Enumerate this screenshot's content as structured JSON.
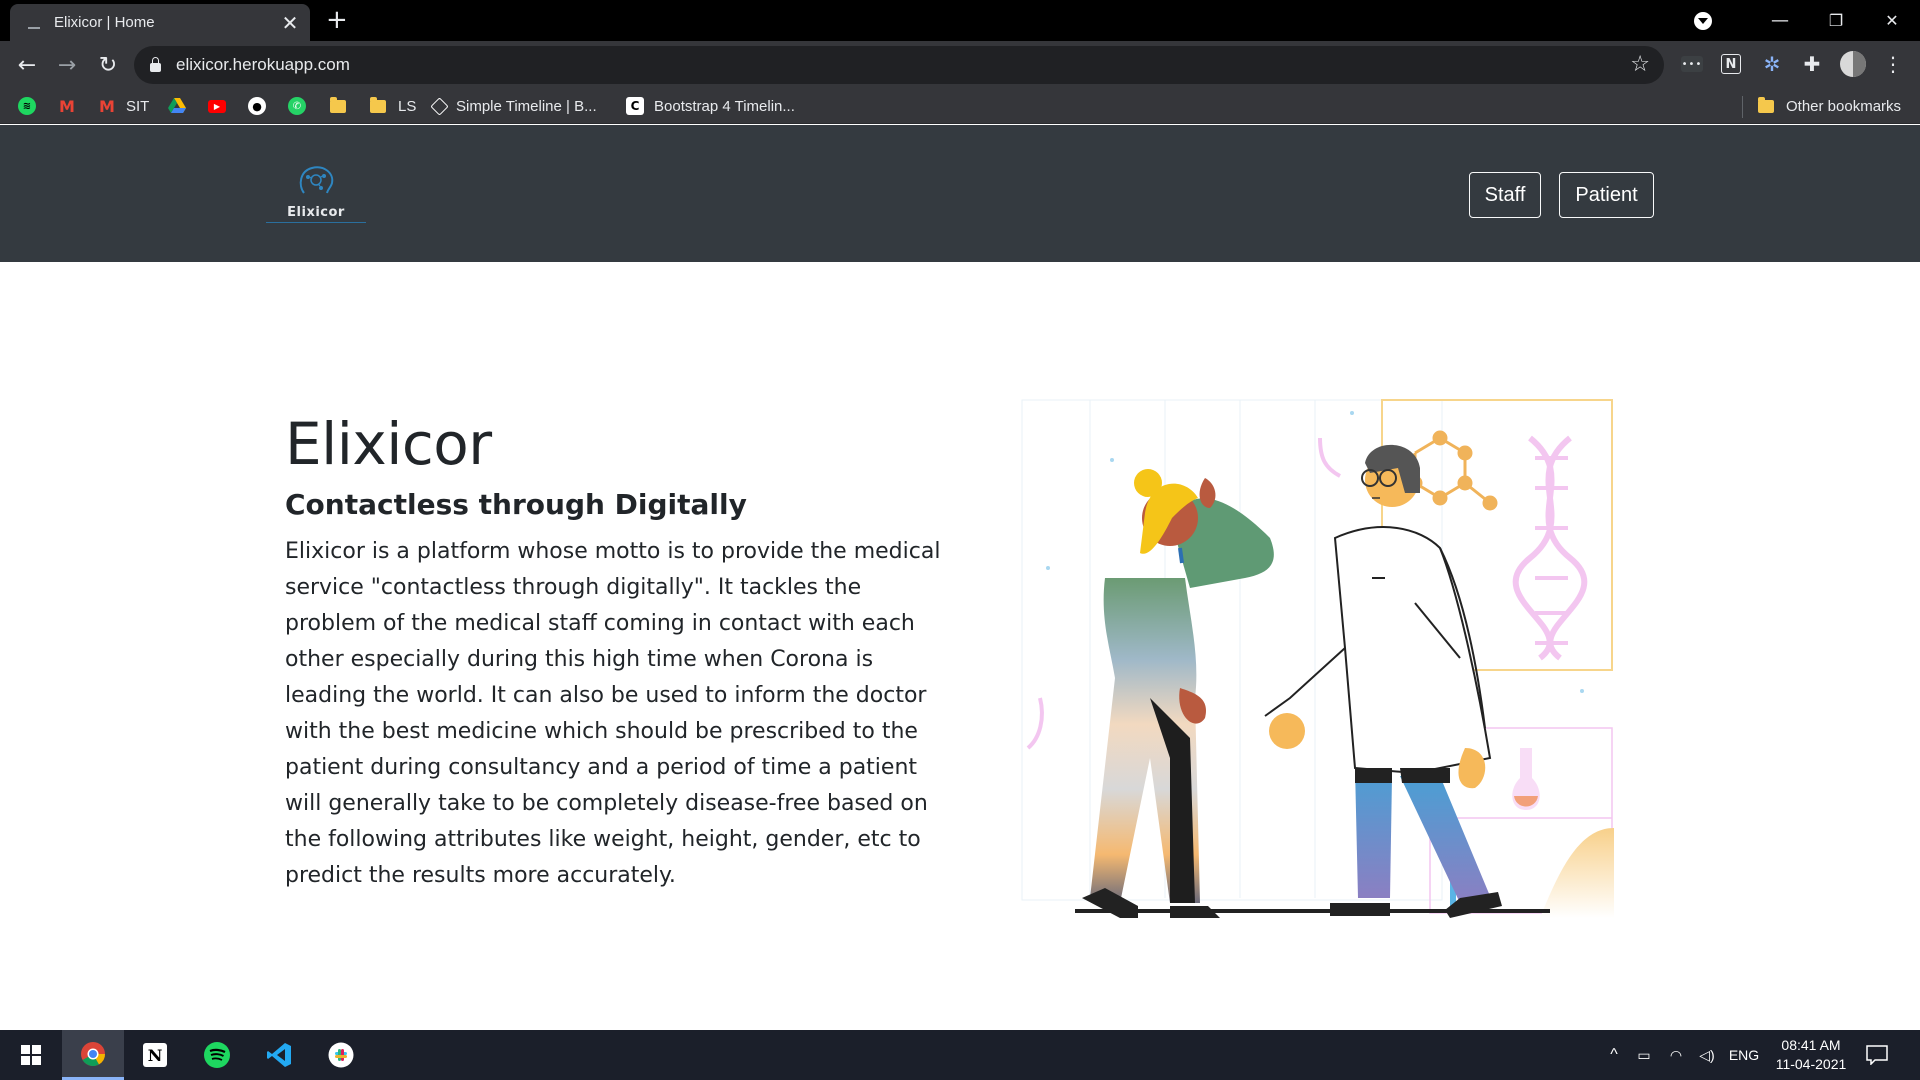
{
  "browser": {
    "tab_title": "Elixicor | Home",
    "tab_close": "✕",
    "new_tab": "+",
    "url": "elixicor.herokuapp.com",
    "bookmarks": [
      {
        "icon": "spotify-icon",
        "label": ""
      },
      {
        "icon": "gmail-icon",
        "label": ""
      },
      {
        "icon": "gmail-icon",
        "label": "SIT"
      },
      {
        "icon": "google-drive-icon",
        "label": ""
      },
      {
        "icon": "youtube-icon",
        "label": ""
      },
      {
        "icon": "github-icon",
        "label": ""
      },
      {
        "icon": "whatsapp-icon",
        "label": ""
      },
      {
        "icon": "folder-icon",
        "label": ""
      },
      {
        "icon": "folder-icon",
        "label": "LS"
      },
      {
        "icon": "codepen-icon",
        "label": "Simple Timeline | B..."
      },
      {
        "icon": "codeply-icon",
        "label": "Bootstrap 4 Timelin..."
      }
    ],
    "other_bookmarks": "Other bookmarks"
  },
  "site": {
    "logo_text": "Elixicor",
    "nav": {
      "staff": "Staff",
      "patient": "Patient"
    },
    "hero": {
      "title": "Elixicor",
      "subtitle": "Contactless through Digitally",
      "body_lines": [
        "Elixicor is a platform whose motto is to provide the medical",
        "service \"contactless through digitally\". It tackles the",
        "problem of the medical staff coming in contact with each",
        "other especially during this high time when Corona is",
        "leading the world. It can also be used to inform the doctor",
        "with the best medicine which should be prescribed to the",
        "patient during consultancy and a period of time a patient",
        "will generally take to be completely disease-free based on",
        "the following attributes like weight, height, gender, etc to",
        "predict the results more accurately."
      ]
    }
  },
  "taskbar": {
    "apps": [
      "windows-start-icon",
      "chrome-icon",
      "notion-icon",
      "spotify-icon",
      "vscode-icon",
      "slack-icon"
    ],
    "language": "ENG",
    "time": "08:41 AM",
    "date": "11-04-2021"
  },
  "colors": {
    "navbar_bg": "#343a40",
    "chrome_dark": "#35363a",
    "accent_blue": "#8ab4f8"
  }
}
